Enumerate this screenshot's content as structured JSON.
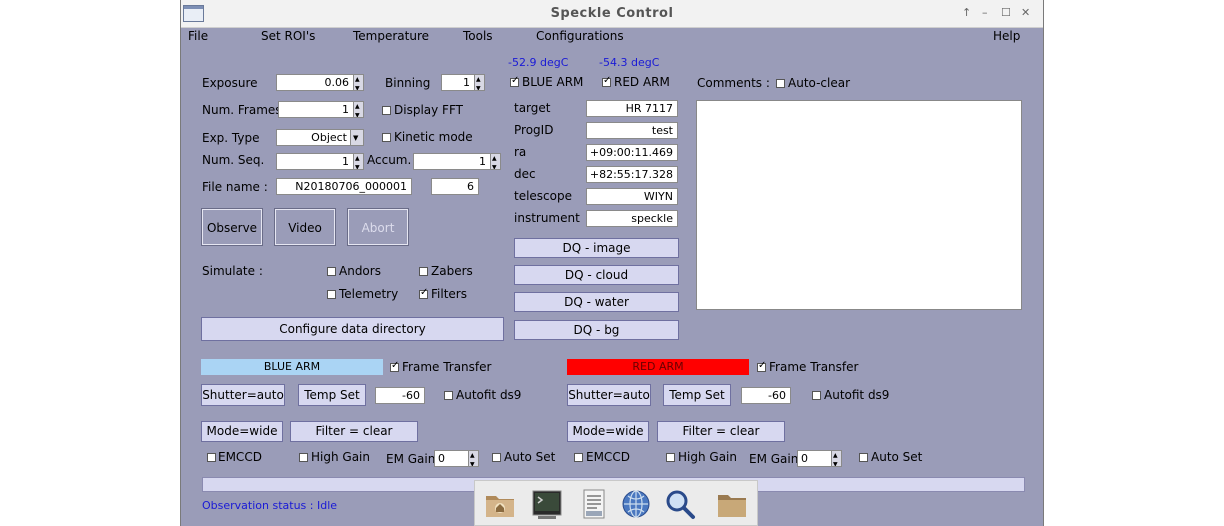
{
  "window": {
    "title": "Speckle Control",
    "controls": {
      "pin": "↑",
      "minimize": "–",
      "maximize": "☐",
      "close": "✕"
    }
  },
  "menu": [
    "File",
    "Set ROI's",
    "Temperature",
    "Tools",
    "Configurations",
    "Help"
  ],
  "camera": {
    "exposure_label": "Exposure",
    "exposure": "0.06",
    "binning_label": "Binning",
    "binning": "1",
    "num_frames_label": "Num. Frames",
    "num_frames": "1",
    "display_fft_label": "Display FFT",
    "exp_type_label": "Exp. Type",
    "exp_type": "Object",
    "kinetic_label": "Kinetic mode",
    "num_seq_label": "Num. Seq.",
    "num_seq": "1",
    "accum_label": "Accum.",
    "accum": "1",
    "file_name_label": "File name :",
    "file_name": "N20180706_000001",
    "file_index": "6"
  },
  "buttons": {
    "observe": "Observe",
    "video": "Video",
    "abort": "Abort",
    "configure": "Configure data directory"
  },
  "simulate": {
    "label": "Simulate :",
    "items": [
      {
        "label": "Andors",
        "checked": false
      },
      {
        "label": "Zabers",
        "checked": false
      },
      {
        "label": "Telemetry",
        "checked": false
      },
      {
        "label": "Filters",
        "checked": true
      }
    ]
  },
  "temps": {
    "blue": "-52.9 degC",
    "red": "-54.3 degC"
  },
  "arm_checks": {
    "blue": "BLUE ARM",
    "red": "RED ARM"
  },
  "target": {
    "fields": [
      {
        "label": "target",
        "value": "HR 7117"
      },
      {
        "label": "ProgID",
        "value": "test"
      },
      {
        "label": "ra",
        "value": "+09:00:11.469"
      },
      {
        "label": "dec",
        "value": "+82:55:17.328"
      },
      {
        "label": "telescope",
        "value": "WIYN"
      },
      {
        "label": "instrument",
        "value": "speckle"
      }
    ]
  },
  "dq": [
    "DQ - image",
    "DQ - cloud",
    "DQ - water",
    "DQ - bg"
  ],
  "comments": {
    "label": "Comments :",
    "autoclear": "Auto-clear"
  },
  "blue_arm": {
    "title": "BLUE ARM",
    "color": "#aad4f4",
    "frame_transfer": "Frame Transfer",
    "shutter": "Shutter=auto",
    "temp_set": "Temp Set",
    "temp": "-60",
    "autofit": "Autofit ds9",
    "mode": "Mode=wide",
    "filter": "Filter = clear",
    "emccd": "EMCCD",
    "high_gain": "High Gain",
    "em_gain_label": "EM Gain",
    "em_gain": "0",
    "auto_set": "Auto Set"
  },
  "red_arm": {
    "title": "RED ARM",
    "color": "#ff0000",
    "frame_transfer": "Frame Transfer",
    "shutter": "Shutter=auto",
    "temp_set": "Temp Set",
    "temp": "-60",
    "autofit": "Autofit ds9",
    "mode": "Mode=wide",
    "filter": "Filter = clear",
    "emccd": "EMCCD",
    "high_gain": "High Gain",
    "em_gain_label": "EM Gain",
    "em_gain": "0",
    "auto_set": "Auto Set"
  },
  "status": "Observation status : Idle",
  "taskbar": [
    "home-folder-icon",
    "terminal-icon",
    "text-editor-icon",
    "web-browser-icon",
    "search-icon",
    "folder-icon"
  ]
}
